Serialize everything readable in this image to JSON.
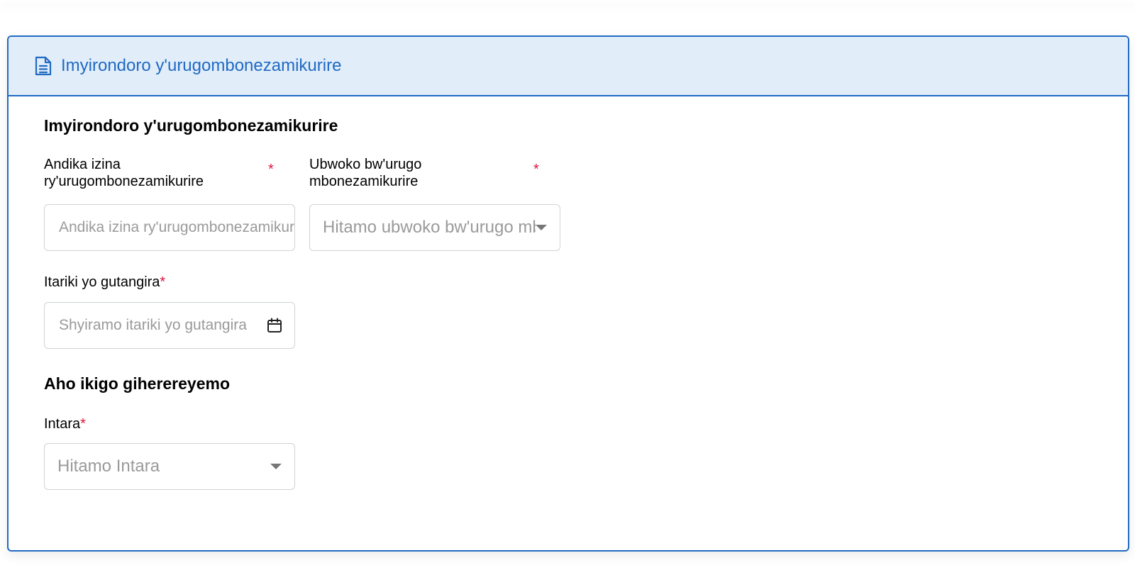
{
  "card": {
    "header_title": "Imyirondoro y'urugombonezamikurire",
    "header_icon": "document-icon"
  },
  "section1": {
    "title": "Imyirondoro y'urugombonezamikurire",
    "name_field": {
      "label": "Andika izina ry'urugombonezamikurire",
      "required_mark": "*",
      "placeholder": "Andika izina ry'urugombonezamikurire"
    },
    "type_field": {
      "label": "Ubwoko bw'urugo mbonezamikurire",
      "required_mark": "*",
      "placeholder": "Hitamo ubwoko bw'urugo mbonezamikurire"
    },
    "start_date_field": {
      "label": "Itariki yo gutangira",
      "required_mark": "*",
      "placeholder": "Shyiramo itariki yo gutangira",
      "icon": "calendar-icon"
    }
  },
  "section2": {
    "title": "Aho ikigo giherereyemo",
    "province_field": {
      "label": "Intara",
      "required_mark": "*",
      "placeholder": "Hitamo Intara"
    }
  },
  "colors": {
    "accent": "#1f6ac4",
    "header_bg": "#e1edf9",
    "required": "#e0143c",
    "placeholder": "#9a9a9a",
    "field_border": "#cfd3d8"
  }
}
